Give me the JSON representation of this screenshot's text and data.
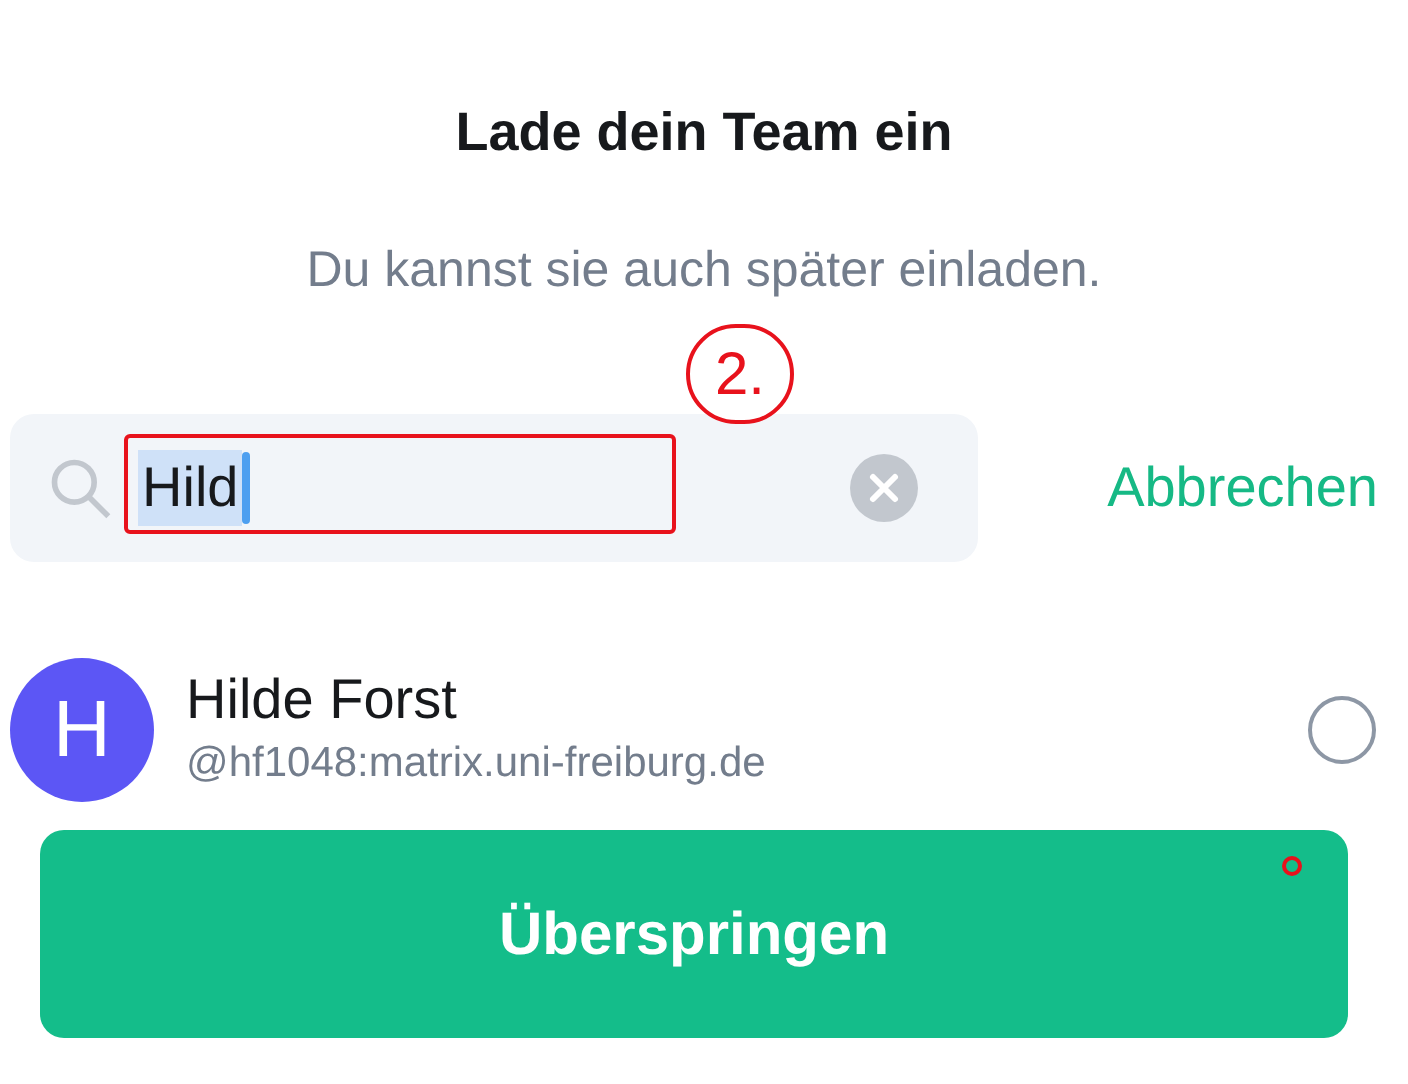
{
  "title": "Lade dein Team ein",
  "subtitle": "Du kannst sie auch später einladen.",
  "search": {
    "value": "Hild",
    "text_selected": true
  },
  "cancel": "Abbrechen",
  "annotation": "2.",
  "users": [
    {
      "initial": "H",
      "name": "Hilde Forst",
      "handle": "@hf1048:matrix.uni-freiburg.de",
      "selected": false
    }
  ],
  "skip_button": "Überspringen"
}
